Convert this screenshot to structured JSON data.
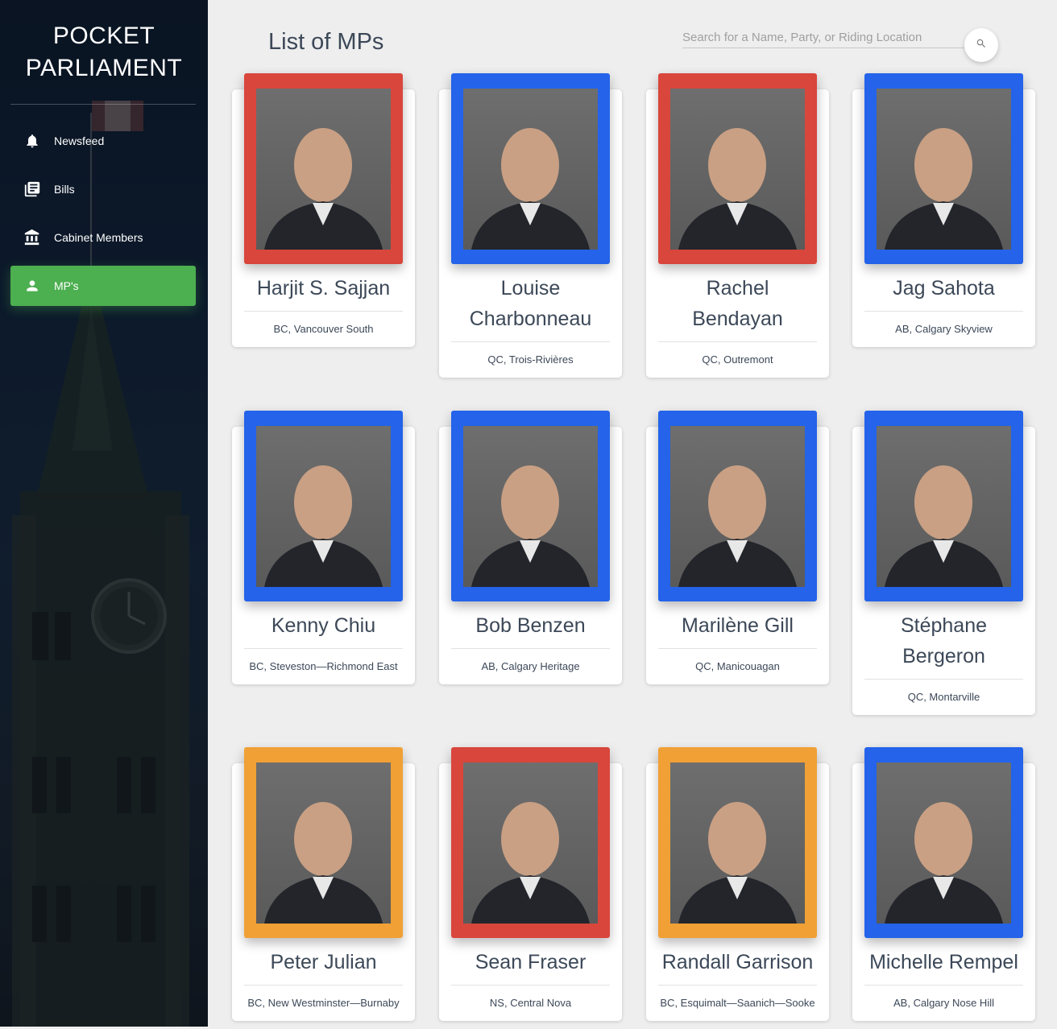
{
  "brand": {
    "line1": "POCKET",
    "line2": "PARLIAMENT"
  },
  "nav": [
    {
      "label": "Newsfeed",
      "icon": "bell-icon",
      "active": false
    },
    {
      "label": "Bills",
      "icon": "library-books-icon",
      "active": false
    },
    {
      "label": "Cabinet Members",
      "icon": "bank-icon",
      "active": false
    },
    {
      "label": "MP's",
      "icon": "person-icon",
      "active": true
    }
  ],
  "header": {
    "title": "List of MPs",
    "search_placeholder": "Search for a Name, Party, or Riding Location"
  },
  "colors": {
    "liberal": "#d9463c",
    "conservative": "#2463ea",
    "ndp": "#f0a035",
    "bloc": "#2463ea",
    "active_nav": "#4caf50"
  },
  "mps": [
    {
      "name_lines": [
        "Harjit S. Sajjan"
      ],
      "riding": "BC, Vancouver South",
      "frame": "red"
    },
    {
      "name_lines": [
        "Louise",
        "Charbonneau"
      ],
      "riding": "QC, Trois-Rivières",
      "frame": "blue"
    },
    {
      "name_lines": [
        "Rachel",
        "Bendayan"
      ],
      "riding": "QC, Outremont",
      "frame": "red"
    },
    {
      "name_lines": [
        "Jag Sahota"
      ],
      "riding": "AB, Calgary Skyview",
      "frame": "blue"
    },
    {
      "name_lines": [
        "Kenny Chiu"
      ],
      "riding": "BC, Steveston—Richmond East",
      "frame": "blue"
    },
    {
      "name_lines": [
        "Bob Benzen"
      ],
      "riding": "AB, Calgary Heritage",
      "frame": "blue"
    },
    {
      "name_lines": [
        "Marilène Gill"
      ],
      "riding": "QC, Manicouagan",
      "frame": "blue"
    },
    {
      "name_lines": [
        "Stéphane",
        "Bergeron"
      ],
      "riding": "QC, Montarville",
      "frame": "blue"
    },
    {
      "name_lines": [
        "Peter Julian"
      ],
      "riding": "BC, New Westminster—Burnaby",
      "frame": "orange"
    },
    {
      "name_lines": [
        "Sean Fraser"
      ],
      "riding": "NS, Central Nova",
      "frame": "red"
    },
    {
      "name_lines": [
        "Randall Garrison"
      ],
      "riding": "BC, Esquimalt—Saanich—Sooke",
      "frame": "orange"
    },
    {
      "name_lines": [
        "Michelle Rempel"
      ],
      "riding": "AB, Calgary Nose Hill",
      "frame": "blue"
    }
  ]
}
